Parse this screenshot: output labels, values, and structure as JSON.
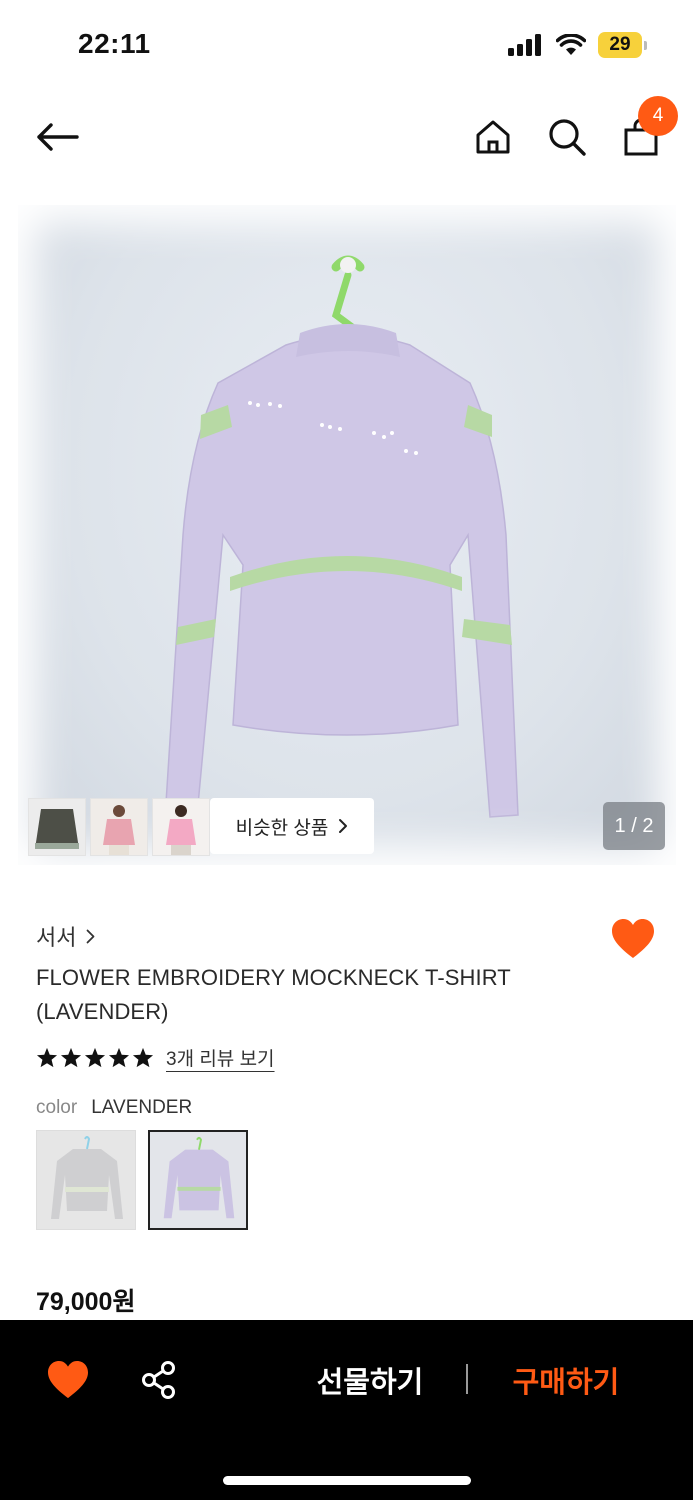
{
  "status_bar": {
    "time": "22:11",
    "battery": "29",
    "signal_icon": "cellular-signal-icon",
    "wifi_icon": "wifi-icon"
  },
  "nav": {
    "back_icon": "arrow-left-icon",
    "home_icon": "home-icon",
    "search_icon": "search-icon",
    "cart_icon": "shopping-bag-icon",
    "cart_count": "4"
  },
  "gallery": {
    "similar_label": "비슷한 상품",
    "counter": "1 / 2"
  },
  "product": {
    "brand": "서서",
    "name": "FLOWER EMBROIDERY MOCKNECK T-SHIRT (LAVENDER)",
    "rating": 5,
    "review_link": "3개 리뷰 보기",
    "color_label": "color",
    "color_value": "LAVENDER",
    "price": "79,000원"
  },
  "bottom_bar": {
    "gift_label": "선물하기",
    "buy_label": "구매하기"
  },
  "colors": {
    "accent": "#ff5a14",
    "badge": "#ff5a14",
    "bottom_bar_bg": "#000000",
    "star": "#111111"
  }
}
